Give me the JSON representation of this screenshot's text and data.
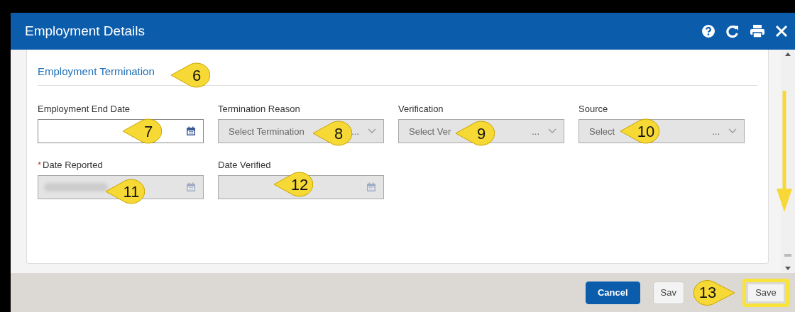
{
  "window": {
    "title": "Employment Details"
  },
  "section": {
    "title": "Employment Termination"
  },
  "fields": [
    {
      "label": "Employment End Date",
      "kind": "date",
      "disabled": false
    },
    {
      "label": "Termination Reason",
      "kind": "select",
      "disabled": true,
      "placeholder": "Select Termination",
      "placeholder_tail": "..."
    },
    {
      "label": "Verification",
      "kind": "select",
      "disabled": true,
      "placeholder": "Select Ver",
      "placeholder_tail": "..."
    },
    {
      "label": "Source",
      "kind": "select",
      "disabled": true,
      "placeholder": "Select",
      "placeholder_tail": "..."
    },
    {
      "label": "Date Reported",
      "kind": "date",
      "disabled": true,
      "required_mark": "*",
      "redacted": true
    },
    {
      "label": "Date Verified",
      "kind": "date",
      "disabled": true
    }
  ],
  "buttons": [
    {
      "label": "Cancel",
      "kind": "primary",
      "highlighted": false
    },
    {
      "label": "Sav",
      "kind": "neutral",
      "highlighted": false
    },
    {
      "label": "Save",
      "kind": "neutral",
      "highlighted": true
    }
  ],
  "callouts": [
    {
      "number": "6"
    },
    {
      "number": "7"
    },
    {
      "number": "8"
    },
    {
      "number": "9"
    },
    {
      "number": "10"
    },
    {
      "number": "11"
    },
    {
      "number": "12"
    }
  ],
  "footer_callout": {
    "number": "13"
  }
}
